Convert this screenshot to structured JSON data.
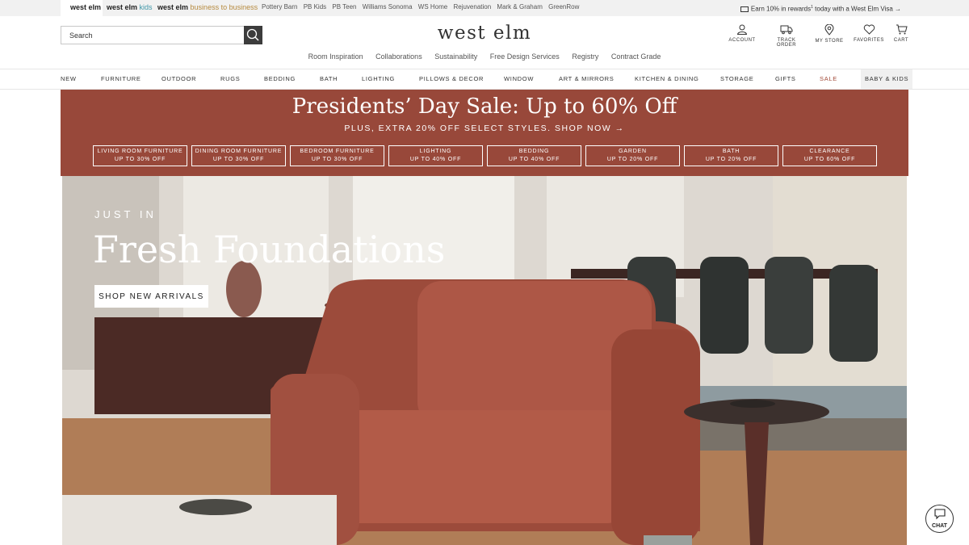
{
  "topbar": {
    "brands": [
      {
        "name": "west elm",
        "suffix": ""
      },
      {
        "name": "west elm",
        "suffix": "kids"
      },
      {
        "name": "west elm",
        "suffix": "business to business"
      }
    ],
    "sister_sites": [
      "Pottery Barn",
      "PB Kids",
      "PB Teen",
      "Williams Sonoma",
      "WS Home",
      "Rejuvenation",
      "Mark & Graham",
      "GreenRow"
    ],
    "rewards": {
      "text": "Earn 10% in rewards",
      "sup": "1",
      "tail": " today with a West Elm Visa →"
    }
  },
  "header": {
    "logo": "west elm",
    "search_placeholder": "Search",
    "utility": {
      "account": "ACCOUNT",
      "track": "TRACK ORDER",
      "store": "MY STORE",
      "favorites": "FAVORITES",
      "cart": "CART"
    }
  },
  "secondary_nav": [
    "Room Inspiration",
    "Collaborations",
    "Sustainability",
    "Free Design Services",
    "Registry",
    "Contract Grade"
  ],
  "main_nav": [
    "NEW",
    "FURNITURE",
    "OUTDOOR",
    "RUGS",
    "BEDDING",
    "BATH",
    "LIGHTING",
    "PILLOWS & DECOR",
    "WINDOW",
    "ART & MIRRORS",
    "KITCHEN & DINING",
    "STORAGE",
    "GIFTS",
    "SALE",
    "BABY & KIDS"
  ],
  "promo": {
    "title": "Presidents’ Day Sale: Up to 60% Off",
    "subtitle": "PLUS, EXTRA 20% OFF SELECT STYLES. SHOP NOW →",
    "boxes": [
      {
        "line1": "LIVING ROOM FURNITURE",
        "line2": "UP TO 30% OFF"
      },
      {
        "line1": "DINING ROOM FURNITURE",
        "line2": "UP TO 30% OFF"
      },
      {
        "line1": "BEDROOM FURNITURE",
        "line2": "UP TO 30% OFF"
      },
      {
        "line1": "LIGHTING",
        "line2": "UP TO 40% OFF"
      },
      {
        "line1": "BEDDING",
        "line2": "UP TO 40% OFF"
      },
      {
        "line1": "GARDEN",
        "line2": "UP TO 20% OFF"
      },
      {
        "line1": "BATH",
        "line2": "UP TO 20% OFF"
      },
      {
        "line1": "CLEARANCE",
        "line2": "UP TO 60% OFF"
      }
    ]
  },
  "hero": {
    "kicker": "JUST IN",
    "title": "Fresh Foundations",
    "cta": "SHOP NEW ARRIVALS"
  },
  "chat": {
    "label": "CHAT"
  },
  "colors": {
    "promo_bg": "#98483a",
    "sale": "#a24a38",
    "kids_accent": "#3f97a8",
    "b2b_accent": "#b68a3e"
  }
}
